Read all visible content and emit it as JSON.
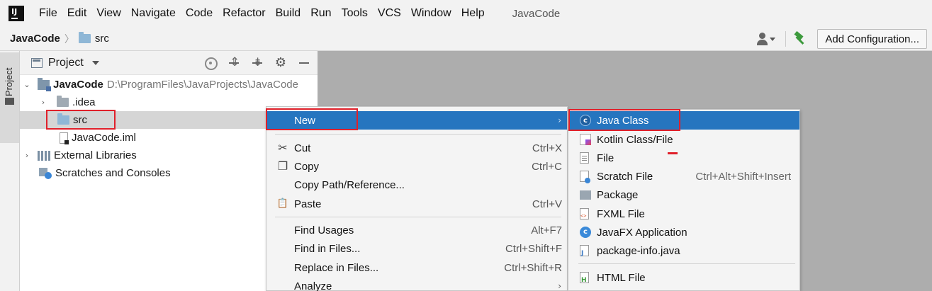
{
  "menubar": {
    "items": [
      {
        "label": "File",
        "mnemonic": "F"
      },
      {
        "label": "Edit",
        "mnemonic": "E"
      },
      {
        "label": "View",
        "mnemonic": "V"
      },
      {
        "label": "Navigate",
        "mnemonic": "N"
      },
      {
        "label": "Code",
        "mnemonic": "C"
      },
      {
        "label": "Refactor",
        "mnemonic": "R"
      },
      {
        "label": "Build",
        "mnemonic": "B"
      },
      {
        "label": "Run",
        "mnemonic": "u"
      },
      {
        "label": "Tools",
        "mnemonic": "T"
      },
      {
        "label": "VCS",
        "mnemonic": "S"
      },
      {
        "label": "Window",
        "mnemonic": "W"
      },
      {
        "label": "Help",
        "mnemonic": "H"
      }
    ],
    "project_title": "JavaCode",
    "logo_text": "IJ"
  },
  "navbar": {
    "root": "JavaCode",
    "separator": "〉",
    "child": "src",
    "config_button": "Add Configuration..."
  },
  "stripe": {
    "project_tab": "Project"
  },
  "project_panel": {
    "title": "Project",
    "tree": [
      {
        "name": "JavaCode",
        "path": "D:\\ProgramFiles\\JavaProjects\\JavaCode",
        "chevron": "⌄"
      },
      {
        "name": ".idea",
        "chevron": "›"
      },
      {
        "name": "src",
        "chevron": ""
      },
      {
        "name": "JavaCode.iml",
        "chevron": ""
      },
      {
        "name": "External Libraries",
        "chevron": "›"
      },
      {
        "name": "Scratches and Consoles",
        "chevron": ""
      }
    ]
  },
  "context_menu": {
    "new": {
      "label": "New",
      "arrow": "›"
    },
    "cut": {
      "label": "Cut",
      "shortcut": "Ctrl+X",
      "icon": "✂"
    },
    "copy": {
      "label": "Copy",
      "shortcut": "Ctrl+C",
      "icon": "❐"
    },
    "copy_path": {
      "label": "Copy Path/Reference..."
    },
    "paste": {
      "label": "Paste",
      "shortcut": "Ctrl+V",
      "icon": "📋"
    },
    "find_usages": {
      "label": "Find Usages",
      "shortcut": "Alt+F7"
    },
    "find_in_files": {
      "label": "Find in Files...",
      "shortcut": "Ctrl+Shift+F"
    },
    "replace_in_files": {
      "label": "Replace in Files...",
      "shortcut": "Ctrl+Shift+R"
    },
    "analyze": {
      "label": "Analyze",
      "arrow": "›"
    }
  },
  "submenu": {
    "items": [
      {
        "label": "Java Class",
        "shortcut": "",
        "icon": "c"
      },
      {
        "label": "Kotlin Class/File",
        "shortcut": "",
        "icon": ""
      },
      {
        "label": "File",
        "shortcut": "",
        "icon": ""
      },
      {
        "label": "Scratch File",
        "shortcut": "Ctrl+Alt+Shift+Insert",
        "icon": ""
      },
      {
        "label": "Package",
        "shortcut": "",
        "icon": ""
      },
      {
        "label": "FXML File",
        "shortcut": "",
        "icon": ""
      },
      {
        "label": "JavaFX Application",
        "shortcut": "",
        "icon": "c"
      },
      {
        "label": "package-info.java",
        "shortcut": "",
        "icon": ""
      },
      {
        "label": "HTML File",
        "shortcut": "",
        "icon": ""
      }
    ]
  },
  "colors": {
    "highlight": "#2675bf",
    "annotation_red": "#e0202a",
    "editor_bg": "#adadad"
  }
}
